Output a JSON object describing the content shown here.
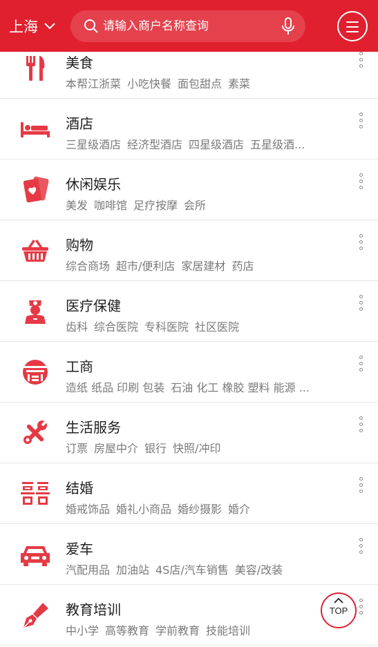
{
  "header": {
    "city": "上海",
    "search_placeholder": "请输入商户名称查询"
  },
  "categories": [
    {
      "title": "美食",
      "subs": [
        "本帮江浙菜",
        "小吃快餐",
        "面包甜点",
        "素菜"
      ]
    },
    {
      "title": "酒店",
      "subs": [
        "三星级酒店",
        "经济型酒店",
        "四星级酒店",
        "五星级酒..."
      ]
    },
    {
      "title": "休闲娱乐",
      "subs": [
        "美发",
        "咖啡馆",
        "足疗按摩",
        "会所"
      ]
    },
    {
      "title": "购物",
      "subs": [
        "综合商场",
        "超市/便利店",
        "家居建材",
        "药店"
      ]
    },
    {
      "title": "医疗保健",
      "subs": [
        "齿科",
        "综合医院",
        "专科医院",
        "社区医院"
      ]
    },
    {
      "title": "工商",
      "subs": [
        "造纸 纸品 印刷 包装",
        "石油 化工 橡胶 塑料 能源 ..."
      ]
    },
    {
      "title": "生活服务",
      "subs": [
        "订票",
        "房屋中介",
        "银行",
        "快照/冲印"
      ]
    },
    {
      "title": "结婚",
      "subs": [
        "婚戒饰品",
        "婚礼小商品",
        "婚纱摄影",
        "婚介"
      ]
    },
    {
      "title": "爱车",
      "subs": [
        "汽配用品",
        "加油站",
        "4S店/汽车销售",
        "美容/改装"
      ]
    },
    {
      "title": "教育培训",
      "subs": [
        "中小学",
        "高等教育",
        "学前教育",
        "技能培训"
      ]
    }
  ],
  "top_button": "TOP",
  "colors": {
    "accent": "#e0202e"
  }
}
